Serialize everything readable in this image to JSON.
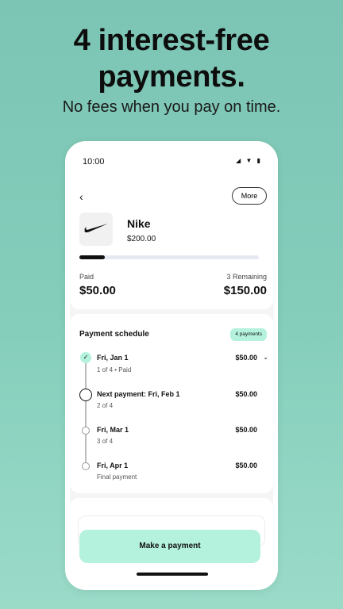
{
  "promo": {
    "headline_line1": "4 interest-free",
    "headline_line2": "payments.",
    "subline": "No fees when you pay on time."
  },
  "status_bar": {
    "time": "10:00",
    "icons": [
      "signal-icon",
      "wifi-icon",
      "battery-icon"
    ]
  },
  "header": {
    "back_icon": "chevron-left-icon",
    "more_label": "More"
  },
  "purchase": {
    "merchant": "Nike",
    "total": "$200.00",
    "progress_fraction": 0.14,
    "paid_label": "Paid",
    "paid_amount": "$50.00",
    "remaining_label": "3 Remaining",
    "remaining_amount": "$150.00"
  },
  "schedule": {
    "title": "Payment schedule",
    "badge": "4 payments",
    "rows": [
      {
        "date": "Fri, Jan 1",
        "sub": "1 of 4 • Paid",
        "amount": "$50.00",
        "state": "paid"
      },
      {
        "date": "Next payment: Fri, Feb 1",
        "sub": "2 of 4",
        "amount": "$50.00",
        "state": "next"
      },
      {
        "date": "Fri, Mar 1",
        "sub": "3 of 4",
        "amount": "$50.00",
        "state": "future"
      },
      {
        "date": "Fri, Apr 1",
        "sub": "Final payment",
        "amount": "$50.00",
        "state": "future"
      }
    ]
  },
  "actions": {
    "make_payment_label": "Make a payment"
  },
  "colors": {
    "accent": "#b4f2de",
    "background": "#84cdbb",
    "text": "#111111"
  }
}
